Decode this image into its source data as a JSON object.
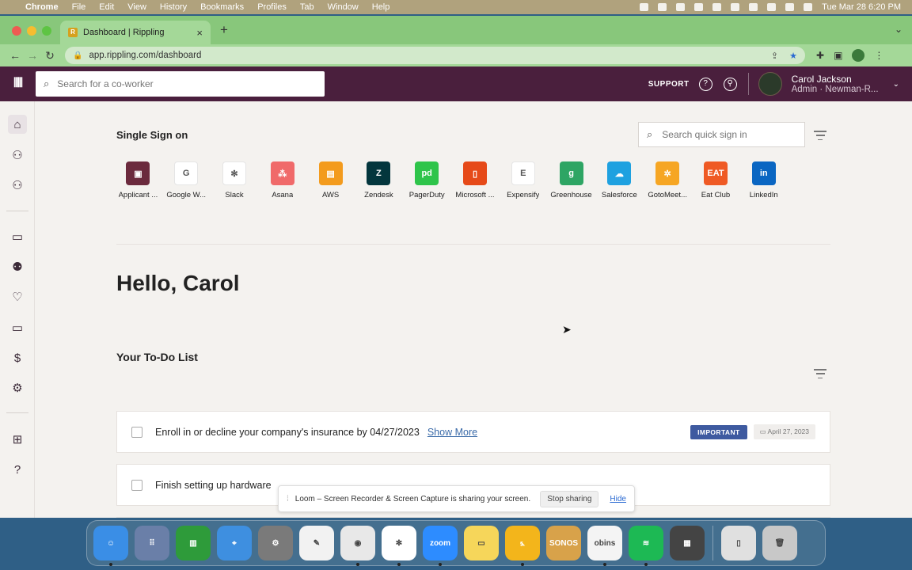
{
  "menubar": {
    "items": [
      "Chrome",
      "File",
      "Edit",
      "View",
      "History",
      "Bookmarks",
      "Profiles",
      "Tab",
      "Window",
      "Help"
    ],
    "clock": "Tue Mar 28  6:20 PM"
  },
  "browser": {
    "tab_title": "Dashboard | Rippling",
    "url": "app.rippling.com/dashboard"
  },
  "header": {
    "search_placeholder": "Search for a co-worker",
    "support": "SUPPORT",
    "user_name": "Carol Jackson",
    "user_role": "Admin · Newman-R..."
  },
  "sso": {
    "title": "Single Sign on",
    "search_placeholder": "Search quick sign in",
    "apps": [
      {
        "name": "Applicant ...",
        "color": "#6b2a3d",
        "glyph": "▣"
      },
      {
        "name": "Google W...",
        "color": "#ffffff",
        "glyph": "G"
      },
      {
        "name": "Slack",
        "color": "#ffffff",
        "glyph": "✻"
      },
      {
        "name": "Asana",
        "color": "#f06a6a",
        "glyph": "⁂"
      },
      {
        "name": "AWS",
        "color": "#f39b1d",
        "glyph": "▤"
      },
      {
        "name": "Zendesk",
        "color": "#03363d",
        "glyph": "Z"
      },
      {
        "name": "PagerDuty",
        "color": "#2ec44a",
        "glyph": "pd"
      },
      {
        "name": "Microsoft ...",
        "color": "#e64a19",
        "glyph": "▯"
      },
      {
        "name": "Expensify",
        "color": "#ffffff",
        "glyph": "E"
      },
      {
        "name": "Greenhouse",
        "color": "#2ea564",
        "glyph": "g"
      },
      {
        "name": "Salesforce",
        "color": "#1ea1e0",
        "glyph": "☁"
      },
      {
        "name": "GotoMeet...",
        "color": "#f6a623",
        "glyph": "✲"
      },
      {
        "name": "Eat Club",
        "color": "#ef5a24",
        "glyph": "EAT"
      },
      {
        "name": "LinkedIn",
        "color": "#0a66c2",
        "glyph": "in"
      }
    ]
  },
  "greeting": "Hello, Carol",
  "todo": {
    "title": "Your To-Do List",
    "items": [
      {
        "text": "Enroll in or decline your company's insurance by 04/27/2023",
        "link": "Show More",
        "badge": "IMPORTANT",
        "date": "April 27, 2023"
      },
      {
        "text": "Finish setting up hardware"
      }
    ]
  },
  "loom": {
    "message": "Loom – Screen Recorder & Screen Capture is sharing your screen.",
    "stop": "Stop sharing",
    "hide": "Hide"
  },
  "dock": [
    {
      "name": "finder",
      "color": "#3a8ee6",
      "glyph": "☺"
    },
    {
      "name": "launchpad",
      "color": "#6a7fa8",
      "glyph": "⠿"
    },
    {
      "name": "numbers",
      "color": "#2e9b3a",
      "glyph": "▥"
    },
    {
      "name": "safari",
      "color": "#3e8fe0",
      "glyph": "⌖"
    },
    {
      "name": "system-preferences",
      "color": "#7a7a7a",
      "glyph": "⚙"
    },
    {
      "name": "pages",
      "color": "#f2f2f2",
      "glyph": "✎"
    },
    {
      "name": "chrome",
      "color": "#e8e8e8",
      "glyph": "◉"
    },
    {
      "name": "slack",
      "color": "#ffffff",
      "glyph": "✻"
    },
    {
      "name": "zoom",
      "color": "#2d8cff",
      "glyph": "zoom"
    },
    {
      "name": "notes",
      "color": "#f6d65a",
      "glyph": "▭"
    },
    {
      "name": "rippling",
      "color": "#f3b51b",
      "glyph": "⦩"
    },
    {
      "name": "sonos",
      "color": "#d8a24a",
      "glyph": "SONOS"
    },
    {
      "name": "obins",
      "color": "#f4f4f4",
      "glyph": "obins"
    },
    {
      "name": "spotify",
      "color": "#1db954",
      "glyph": "≋"
    },
    {
      "name": "calculator",
      "color": "#444444",
      "glyph": "▦"
    },
    {
      "name": "documents",
      "color": "#e0e0e0",
      "glyph": "▯"
    },
    {
      "name": "trash",
      "color": "#c8c8c8",
      "glyph": "🗑"
    }
  ]
}
